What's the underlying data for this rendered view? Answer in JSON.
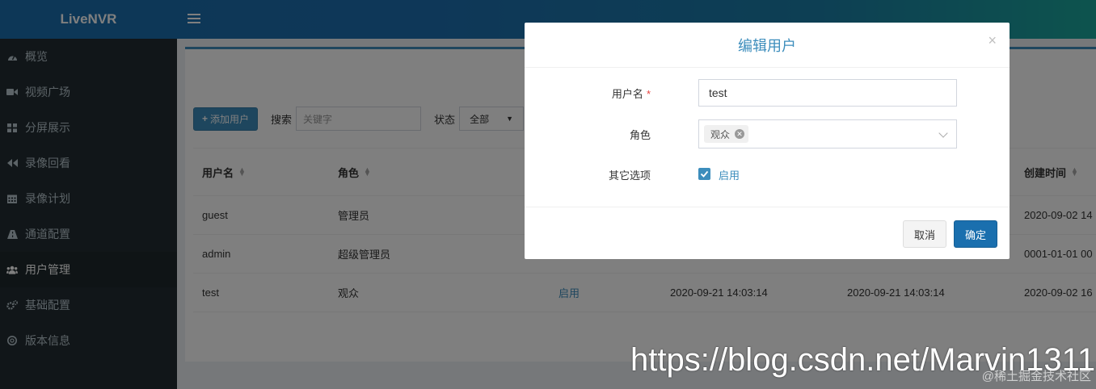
{
  "app": {
    "title": "LiveNVR"
  },
  "sidebar": {
    "items": [
      {
        "label": "概览",
        "icon": "dashboard-icon",
        "active": false
      },
      {
        "label": "视频广场",
        "icon": "video-camera-icon",
        "active": false
      },
      {
        "label": "分屏展示",
        "icon": "grid-icon",
        "active": false
      },
      {
        "label": "录像回看",
        "icon": "rewind-icon",
        "active": false
      },
      {
        "label": "录像计划",
        "icon": "calendar-icon",
        "active": false
      },
      {
        "label": "通道配置",
        "icon": "road-icon",
        "active": false
      },
      {
        "label": "用户管理",
        "icon": "users-icon",
        "active": true
      },
      {
        "label": "基础配置",
        "icon": "cogs-icon",
        "active": false
      },
      {
        "label": "版本信息",
        "icon": "info-icon",
        "active": false
      }
    ]
  },
  "toolbar": {
    "add_user_label": "添加用户",
    "search_label": "搜索",
    "search_placeholder": "关键字",
    "status_label": "状态",
    "status_value": "全部"
  },
  "table": {
    "headers": [
      "用户名",
      "角色",
      "创建时间"
    ],
    "rows": [
      {
        "username": "guest",
        "role": "管理员",
        "status": "",
        "time1": "",
        "time2": "",
        "created": "2020-09-02 14"
      },
      {
        "username": "admin",
        "role": "超级管理员",
        "status": "",
        "time1": "",
        "time2": "",
        "created": "0001-01-01 00"
      },
      {
        "username": "test",
        "role": "观众",
        "status": "启用",
        "time1": "2020-09-21 14:03:14",
        "time2": "2020-09-21 14:03:14",
        "created": "2020-09-02 16"
      }
    ]
  },
  "modal": {
    "title": "编辑用户",
    "close_symbol": "×",
    "username_label": "用户名",
    "required_mark": "*",
    "username_value": "test",
    "role_label": "角色",
    "role_tag": "观众",
    "other_label": "其它选项",
    "enabled_label": "启用",
    "enabled_checked": true,
    "cancel_label": "取消",
    "ok_label": "确定"
  },
  "watermark": {
    "url": "https://blog.csdn.net/Marvin1311",
    "community": "@稀土掘金技术社区"
  },
  "colors": {
    "accent": "#3c8dbc",
    "sidebar_bg": "#222d32",
    "primary_button": "#1a6fae"
  }
}
